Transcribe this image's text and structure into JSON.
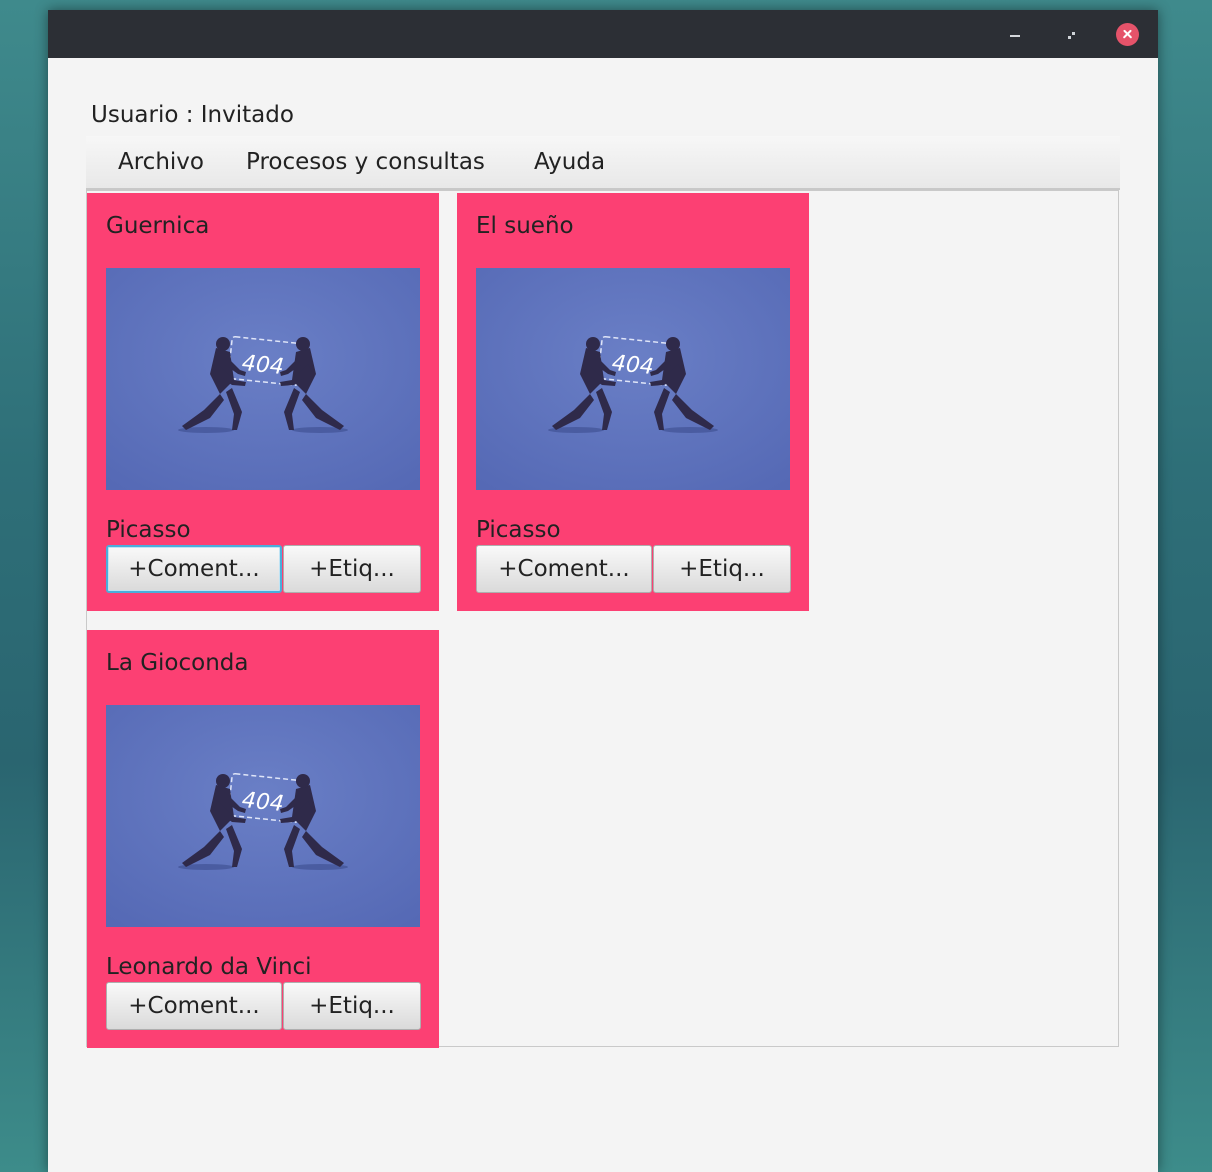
{
  "window": {
    "title": ""
  },
  "user": {
    "label": "Usuario : Invitado"
  },
  "menu": {
    "items": [
      "Archivo",
      "Procesos y consultas",
      "Ayuda"
    ]
  },
  "cards": [
    {
      "title": "Guernica",
      "author": "Picasso",
      "image_text": "404",
      "comment_button": "+Coment...",
      "tag_button": "+Etiq..."
    },
    {
      "title": "El sueño",
      "author": "Picasso",
      "image_text": "404",
      "comment_button": "+Coment...",
      "tag_button": "+Etiq..."
    },
    {
      "title": "La Gioconda",
      "author": "Leonardo da Vinci",
      "image_text": "404",
      "comment_button": "+Coment...",
      "tag_button": "+Etiq..."
    }
  ],
  "colors": {
    "card_bg": "#fc4073",
    "image_bg": "#5569b5",
    "focus_ring": "#4aaedb",
    "titlebar": "#2c2f35"
  },
  "icons": {
    "minimize": "minimize-icon",
    "maximize": "maximize-icon",
    "close": "close-icon"
  }
}
